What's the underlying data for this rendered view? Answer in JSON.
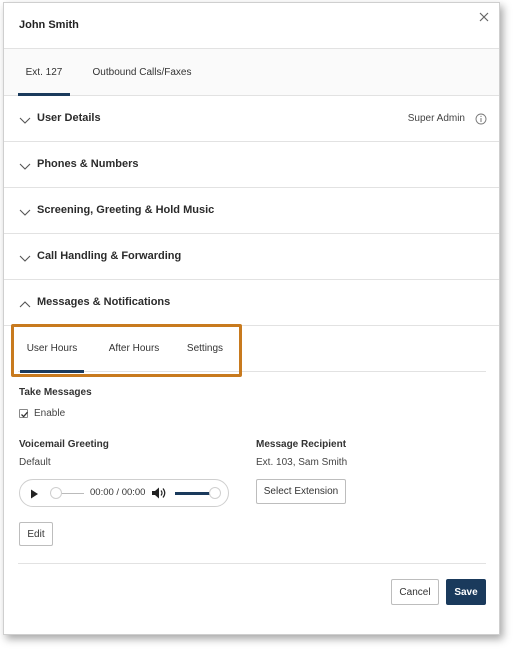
{
  "dialog": {
    "title": "John Smith"
  },
  "top_tabs": [
    {
      "label": "Ext. 127",
      "active": true
    },
    {
      "label": "Outbound Calls/Faxes",
      "active": false
    }
  ],
  "sections": [
    {
      "label": "User Details",
      "right_note": "Super Admin",
      "expanded": false
    },
    {
      "label": "Phones & Numbers",
      "expanded": false
    },
    {
      "label": "Screening, Greeting & Hold Music",
      "expanded": false
    },
    {
      "label": "Call Handling & Forwarding",
      "expanded": false
    },
    {
      "label": "Messages & Notifications",
      "expanded": true
    }
  ],
  "sub_tabs": [
    {
      "label": "User Hours",
      "active": true
    },
    {
      "label": "After Hours",
      "active": false
    },
    {
      "label": "Settings",
      "active": false
    }
  ],
  "take_messages": {
    "heading": "Take Messages",
    "enable_label": "Enable",
    "enabled": true
  },
  "voicemail": {
    "heading": "Voicemail Greeting",
    "value": "Default",
    "time": "00:00 / 00:00",
    "volume_fraction": 0.9,
    "edit_label": "Edit"
  },
  "recipient": {
    "heading": "Message Recipient",
    "value": "Ext. 103, Sam Smith",
    "select_label": "Select Extension"
  },
  "footer": {
    "cancel_label": "Cancel",
    "save_label": "Save"
  },
  "colors": {
    "accent": "#1a3a5c",
    "highlight": "#c87a1e"
  },
  "icons": [
    "close-icon",
    "chevron-down-icon",
    "chevron-up-icon",
    "info-icon",
    "checkmark-icon",
    "play-icon",
    "volume-icon"
  ]
}
